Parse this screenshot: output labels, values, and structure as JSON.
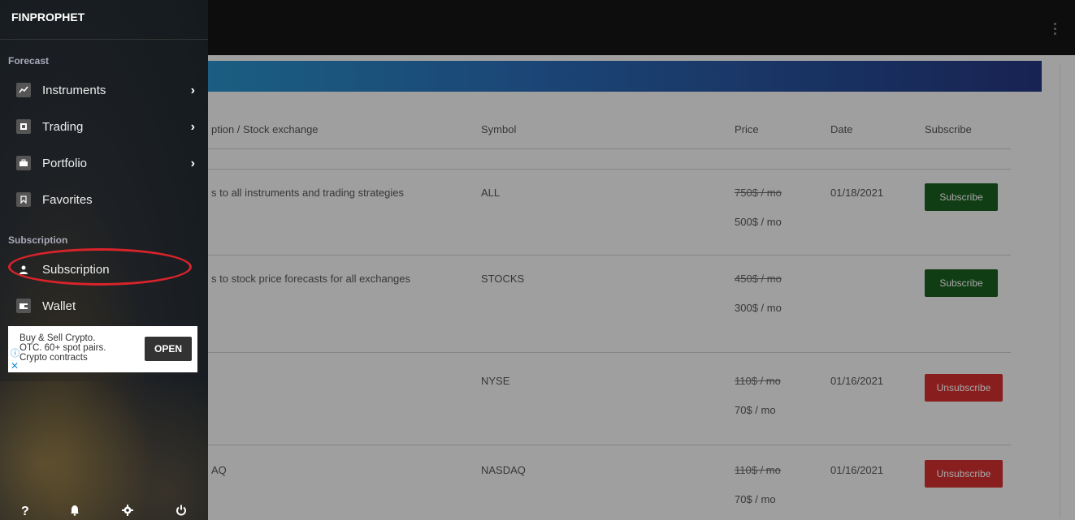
{
  "app": {
    "brand": "FINPROPHET"
  },
  "sidebar": {
    "sections": {
      "forecast": "Forecast",
      "subscription": "Subscription"
    },
    "items": [
      {
        "label": "Instruments",
        "icon": "chart-icon"
      },
      {
        "label": "Trading",
        "icon": "trading-icon"
      },
      {
        "label": "Portfolio",
        "icon": "briefcase-icon"
      },
      {
        "label": "Favorites",
        "icon": "bookmark-icon"
      },
      {
        "label": "Subscription",
        "icon": "person-icon"
      },
      {
        "label": "Wallet",
        "icon": "wallet-icon"
      }
    ],
    "chevron": "›",
    "bottom_icons": [
      "?",
      "bell-icon",
      "gear-icon",
      "power-icon"
    ]
  },
  "ad": {
    "line1": "Buy & Sell Crypto.",
    "line2": "OTC. 60+ spot pairs.",
    "line3": "Crypto contracts",
    "button": "OPEN"
  },
  "table": {
    "headers": {
      "description": "ption / Stock exchange",
      "symbol": "Symbol",
      "price": "Price",
      "date": "Date",
      "subscribe": "Subscribe"
    },
    "rows": [
      {
        "description": "s to all instruments and trading strategies",
        "symbol": "ALL",
        "old_price": "750$ / mo",
        "new_price": "500$ / mo",
        "date": "01/18/2021",
        "action": "Subscribe"
      },
      {
        "description": "s to stock price forecasts for all exchanges",
        "symbol": "STOCKS",
        "old_price": "450$ / mo",
        "new_price": "300$ / mo",
        "date": "",
        "action": "Subscribe"
      },
      {
        "description": "",
        "symbol": "NYSE",
        "old_price": "110$ / mo",
        "new_price": "70$ / mo",
        "date": "01/16/2021",
        "action": "Unsubscribe"
      },
      {
        "description": "AQ",
        "symbol": "NASDAQ",
        "old_price": "110$ / mo",
        "new_price": "70$ / mo",
        "date": "01/16/2021",
        "action": "Unsubscribe"
      }
    ]
  },
  "colors": {
    "subscribe_button": "#1b5e20",
    "unsubscribe_button": "#d32f2f",
    "highlight_circle": "#d9232a"
  }
}
